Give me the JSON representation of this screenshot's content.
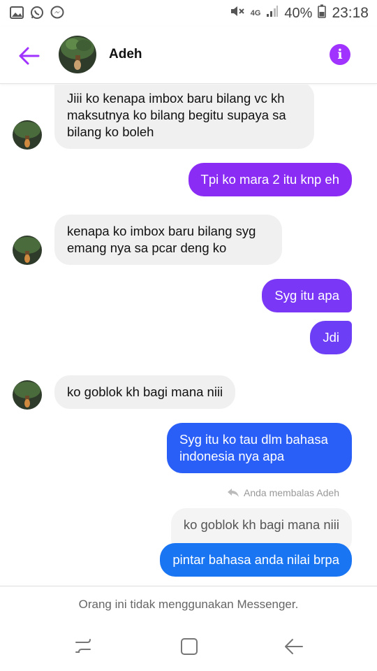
{
  "status_bar": {
    "left_icons": [
      "gallery-icon",
      "whatsapp-icon",
      "messenger-icon"
    ],
    "network": "4G",
    "battery_percent": "40%",
    "time": "23:18"
  },
  "header": {
    "contact_name": "Adeh",
    "accent_color": "#a033ff"
  },
  "messages": [
    {
      "direction": "incoming",
      "text": "Jiii ko kenapa imbox baru bilang vc kh maksutnya ko bilang begitu supaya sa bilang ko boleh"
    },
    {
      "direction": "outgoing",
      "text": "Tpi ko mara 2 itu knp eh",
      "color": "#8a2cf4"
    },
    {
      "direction": "incoming",
      "text": "kenapa ko imbox baru bilang syg emang nya sa pcar deng ko"
    },
    {
      "direction": "outgoing",
      "text": "Syg itu apa",
      "color": "#7a37f6"
    },
    {
      "direction": "outgoing",
      "text": "Jdi",
      "color": "#6c3ef6"
    },
    {
      "direction": "incoming",
      "text": "ko goblok kh bagi mana niii"
    },
    {
      "direction": "outgoing",
      "text": "Syg itu ko tau dlm bahasa indonesia nya apa",
      "color": "#2a5ff7"
    },
    {
      "direction": "outgoing",
      "text": "pintar bahasa anda nilai brpa",
      "color": "#1a75f2"
    }
  ],
  "reply": {
    "note": "Anda membalas Adeh",
    "quoted_text": "ko goblok kh bagi mana niii"
  },
  "notice": "Orang ini tidak menggunakan Messenger.",
  "nav": {
    "buttons": [
      "recent-apps-icon",
      "home-icon",
      "back-icon"
    ]
  }
}
